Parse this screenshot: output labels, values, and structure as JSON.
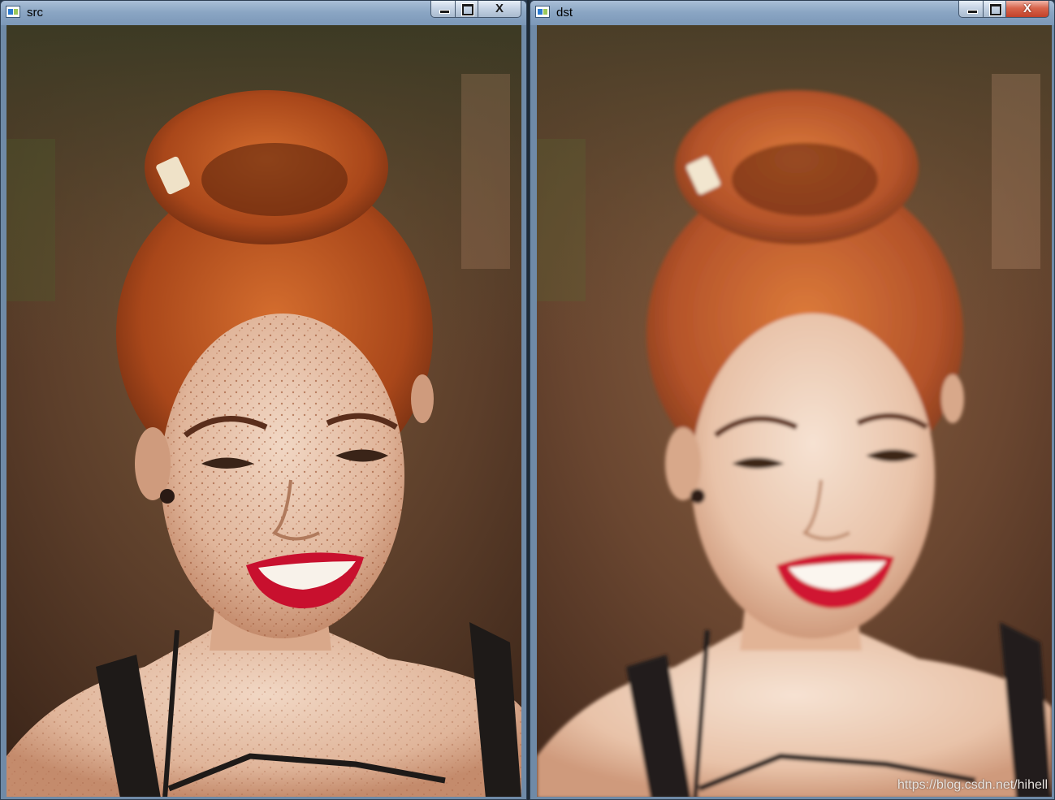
{
  "windows": [
    {
      "id": "src",
      "title": "src",
      "image_label": "original portrait photo"
    },
    {
      "id": "dst",
      "title": "dst",
      "image_label": "skin-smoothed portrait photo"
    }
  ],
  "caption_buttons": {
    "close_glyph": "X"
  },
  "watermark": "https://blog.csdn.net/hihell",
  "colors": {
    "titlebar": "#8ba6c4",
    "close_active": "#c2412a",
    "hair": "#b9551f",
    "lips": "#c8102e"
  },
  "icons": [
    "app-icon",
    "minimize-icon",
    "maximize-icon",
    "close-icon"
  ]
}
